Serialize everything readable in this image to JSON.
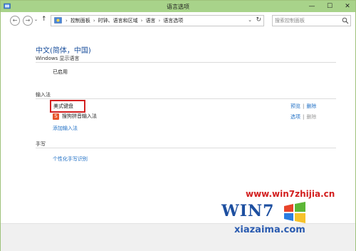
{
  "window": {
    "title": "语言选项",
    "controls": {
      "minimize": "—",
      "maximize": "☐",
      "close": "✕"
    }
  },
  "address": {
    "crumbs": [
      "控制面板",
      "时钟、语言和区域",
      "语言",
      "语言选项"
    ],
    "separator": "›",
    "search_placeholder": "搜索控制面板"
  },
  "language": {
    "name": "中文(简体，中国)",
    "display_section": "Windows 显示语言",
    "display_status": "已启用",
    "ime_section": "输入法",
    "ime": [
      {
        "name": "美式键盘",
        "actions": [
          "预览",
          "删除"
        ],
        "disabled": []
      },
      {
        "name": "搜狗拼音输入法",
        "actions": [
          "选项",
          "删除"
        ],
        "disabled": [
          "删除"
        ]
      }
    ],
    "add_ime": "添加输入法",
    "handwriting_section": "手写",
    "handwriting_link": "个性化手写识别"
  },
  "watermark": {
    "url": "www.win7zhijia.cn",
    "logo": "WIN7",
    "site": "xiazaima.com"
  },
  "colors": {
    "titlebar": "#a8d38a",
    "link": "#1f6fc5",
    "heading": "#1a4f9c",
    "highlight": "#d32020"
  }
}
